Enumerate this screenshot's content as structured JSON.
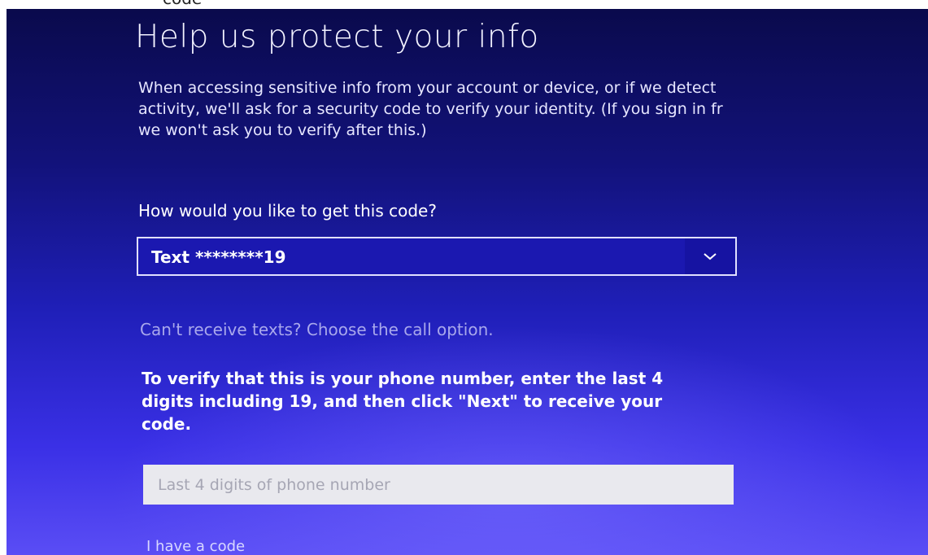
{
  "top_fragment": "code",
  "page": {
    "title": "Help us protect your info",
    "intro": "When accessing sensitive info from your account or device, or if we detect\nactivity, we'll ask for a security code to verify your identity. (If you sign in fr\nwe won't ask you to verify after this.)"
  },
  "method": {
    "question": "How would you like to get this code?",
    "selected": "Text ********19",
    "chevron_icon": "chevron-down-icon"
  },
  "call_option_link": "Can't receive texts? Choose the call option.",
  "verify": {
    "instructions": "To verify that this is your phone number, enter the last 4\ndigits including 19, and then click \"Next\" to receive your\ncode.",
    "input_placeholder": "Last 4 digits of phone number",
    "input_value": ""
  },
  "have_code_link": "I have a code",
  "colors": {
    "background_top": "#0a0a4c",
    "background_bottom": "#5a4df5",
    "select_fill": "#1b18b0",
    "link": "#a9a8ec",
    "input_fill": "#e9e9ee"
  }
}
